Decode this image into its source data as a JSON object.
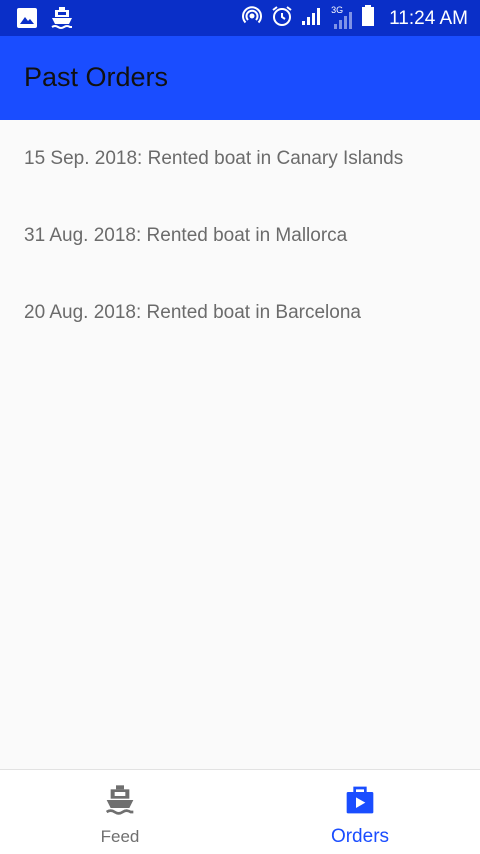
{
  "status_bar": {
    "time": "11:24 AM",
    "network_label": "3G",
    "left_icons": [
      "image-icon",
      "boat-notification-icon"
    ],
    "right_icons": [
      "hotspot-icon",
      "alarm-icon",
      "signal-icon",
      "signal-3g-icon",
      "battery-icon"
    ]
  },
  "app_bar": {
    "title": "Past Orders"
  },
  "orders": [
    {
      "text": "15 Sep. 2018: Rented boat in Canary Islands"
    },
    {
      "text": "31 Aug. 2018: Rented boat in Mallorca"
    },
    {
      "text": "20 Aug. 2018: Rented boat in Barcelona"
    }
  ],
  "bottom_nav": {
    "items": [
      {
        "label": "Feed",
        "icon": "boat-icon",
        "active": false
      },
      {
        "label": "Orders",
        "icon": "orders-bag-icon",
        "active": true
      }
    ]
  },
  "colors": {
    "status_bar": "#0a2fc8",
    "app_bar": "#1a4dff",
    "accent": "#1a4dff",
    "background": "#fafafa",
    "text_secondary": "#6b6b6b"
  }
}
